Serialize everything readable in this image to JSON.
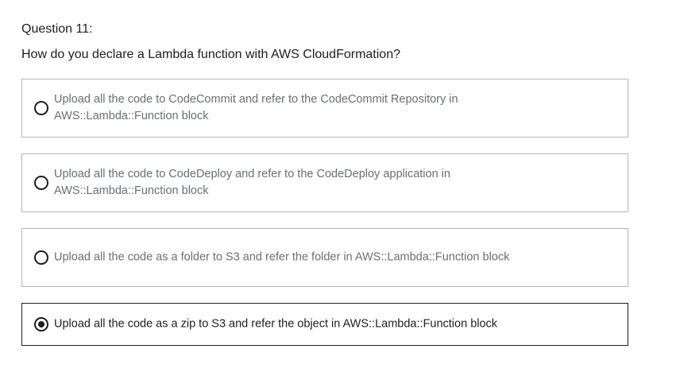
{
  "question": {
    "number_label": "Question 11:",
    "text": "How do you declare a Lambda function with AWS CloudFormation?"
  },
  "options": [
    {
      "label": "Upload all the code to CodeCommit and refer to the CodeCommit Repository in AWS::Lambda::Function block",
      "selected": false
    },
    {
      "label": "Upload all the code to CodeDeploy and refer to the CodeDeploy application in AWS::Lambda::Function block",
      "selected": false
    },
    {
      "label": "Upload all the code as a folder to S3 and refer the folder in AWS::Lambda::Function block",
      "selected": false
    },
    {
      "label": "Upload all the code as a zip to S3 and refer the object in AWS::Lambda::Function block",
      "selected": true
    }
  ],
  "colors": {
    "text_primary": "#1c1d1f",
    "text_muted": "#6a6f73",
    "border_default": "#b5b5b5",
    "border_selected": "#1c1d1f"
  }
}
